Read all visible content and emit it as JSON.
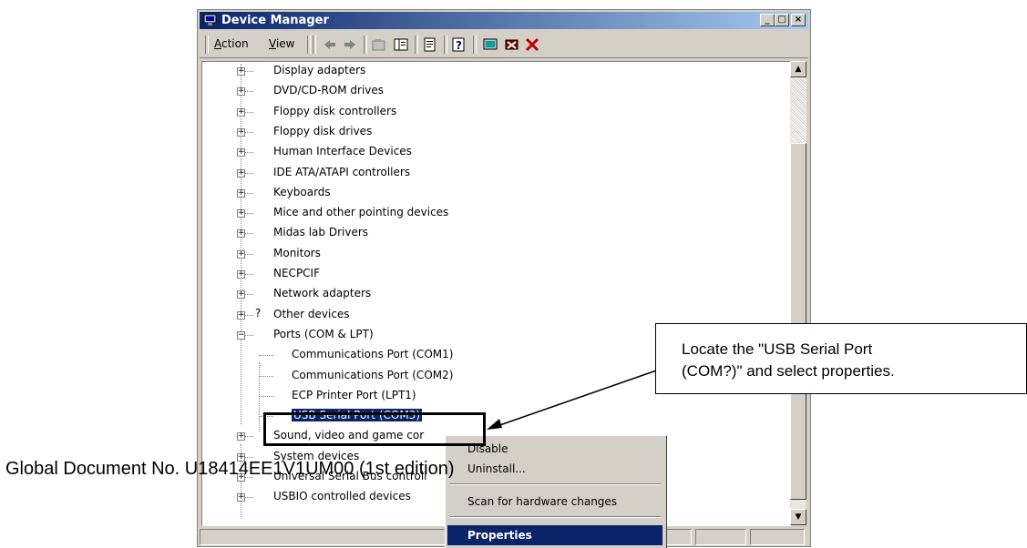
{
  "window": {
    "title": "Device Manager",
    "controls": {
      "minimize": "_",
      "maximize": "□",
      "close": "×"
    }
  },
  "menu": {
    "action": "Action",
    "action_key": "A",
    "action_rest": "ction",
    "view": "View",
    "view_key": "V",
    "view_rest": "iew"
  },
  "tree": {
    "categories": [
      {
        "label": "Display adapters",
        "icon": "monitor-icon"
      },
      {
        "label": "DVD/CD-ROM drives",
        "icon": "disc-drive-icon"
      },
      {
        "label": "Floppy disk controllers",
        "icon": "controller-icon"
      },
      {
        "label": "Floppy disk drives",
        "icon": "floppy-drive-icon"
      },
      {
        "label": "Human Interface Devices",
        "icon": "hid-icon"
      },
      {
        "label": "IDE ATA/ATAPI controllers",
        "icon": "controller-icon"
      },
      {
        "label": "Keyboards",
        "icon": "keyboard-icon"
      },
      {
        "label": "Mice and other pointing devices",
        "icon": "mouse-icon"
      },
      {
        "label": "Midas lab Drivers",
        "icon": "diamond-icon"
      },
      {
        "label": "Monitors",
        "icon": "monitor-icon"
      },
      {
        "label": "NECPCIF",
        "icon": "diamond-icon"
      },
      {
        "label": "Network adapters",
        "icon": "network-icon"
      },
      {
        "label": "Other devices",
        "icon": "question-icon"
      },
      {
        "label": "Ports (COM & LPT)",
        "icon": "port-icon"
      }
    ],
    "ports": [
      {
        "label": "Communications Port (COM1)"
      },
      {
        "label": "Communications Port (COM2)"
      },
      {
        "label": "ECP Printer Port (LPT1)"
      },
      {
        "label": "USB Serial Port (COM3)",
        "selected": true
      }
    ],
    "after": [
      {
        "label": "Sound, video and game cor",
        "icon": "sound-icon"
      },
      {
        "label": "System devices",
        "icon": "computer-icon"
      },
      {
        "label": "Universal Serial Bus controll",
        "icon": "usb-icon"
      },
      {
        "label": "USBIO controlled devices",
        "icon": "usb-icon"
      }
    ]
  },
  "context_menu": {
    "disable": "Disable",
    "uninstall": "Uninstall...",
    "scan": "Scan for hardware changes",
    "properties": "Properties"
  },
  "callout": {
    "text": "Locate the \"USB Serial Port\n(COM?)\" and select properties."
  },
  "footer": {
    "text": "Global Document No. U18414EE1V1UM00 (1st edition)"
  },
  "colors": {
    "selection": "#0a246a",
    "titlebar_start": "#0a246a",
    "titlebar_end": "#a6caf0",
    "face": "#d4d0c8"
  }
}
